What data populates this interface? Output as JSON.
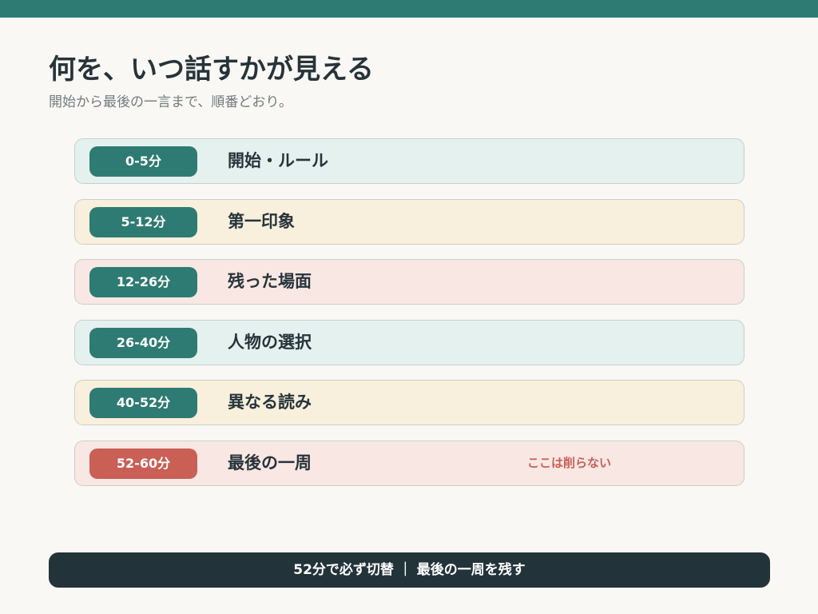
{
  "colors": {
    "accent": "#2e7b73",
    "warning": "#c95f55",
    "dark": "#23333a",
    "background": "#faf8f4"
  },
  "header": {
    "title": "何を、いつ話すかが見える",
    "subtitle": "開始から最後の一言まで、順番どおり。"
  },
  "agenda": {
    "items": [
      {
        "time": "0-5分",
        "label": "開始・ルール",
        "note": ""
      },
      {
        "time": "5-12分",
        "label": "第一印象",
        "note": ""
      },
      {
        "time": "12-26分",
        "label": "残った場面",
        "note": ""
      },
      {
        "time": "26-40分",
        "label": "人物の選択",
        "note": ""
      },
      {
        "time": "40-52分",
        "label": "異なる読み",
        "note": ""
      },
      {
        "time": "52-60分",
        "label": "最後の一周",
        "note": "ここは削らない"
      }
    ]
  },
  "footer": {
    "text": "52分で必ず切替 ｜ 最後の一周を残す"
  }
}
